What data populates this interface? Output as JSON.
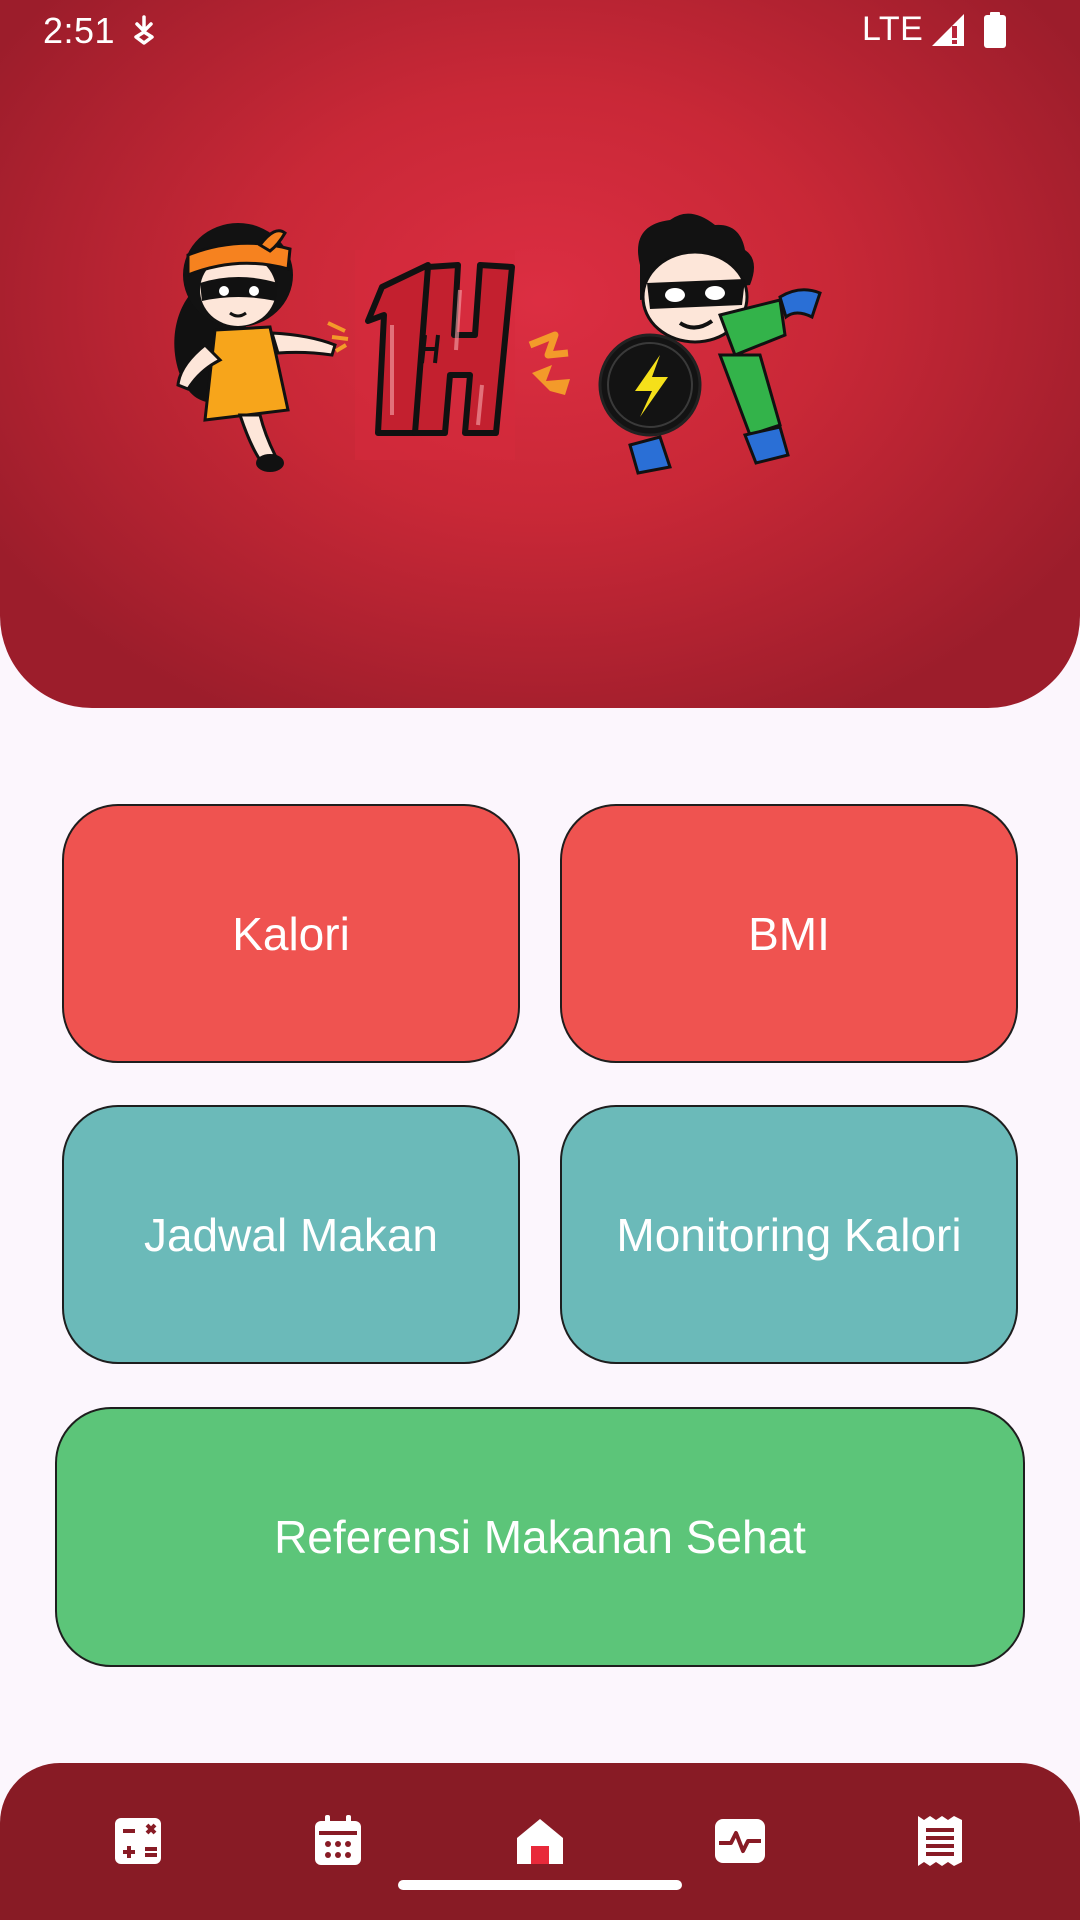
{
  "status_bar": {
    "time": "2:51",
    "network": "LTE",
    "icons": [
      "download-icon",
      "signal-icon",
      "battery-icon"
    ]
  },
  "header": {
    "logo_text": "1H",
    "illustration": "superhero-girl-and-boy-mascots",
    "colors": {
      "center": "#dc2e42",
      "edge": "#9c1d2b"
    }
  },
  "menu": {
    "kalori": "Kalori",
    "bmi": "BMI",
    "jadwal_makan": "Jadwal Makan",
    "monitoring_kalori": "Monitoring Kalori",
    "referensi": "Referensi Makanan Sehat"
  },
  "colors": {
    "tile_red": "#ef5350",
    "tile_teal": "#6bbab9",
    "tile_green": "#5cc579",
    "nav_background": "#881b25"
  },
  "bottom_nav": {
    "items": [
      "calculator-icon",
      "calendar-icon",
      "home-icon",
      "activity-icon",
      "receipt-icon"
    ],
    "active": "home-icon"
  }
}
